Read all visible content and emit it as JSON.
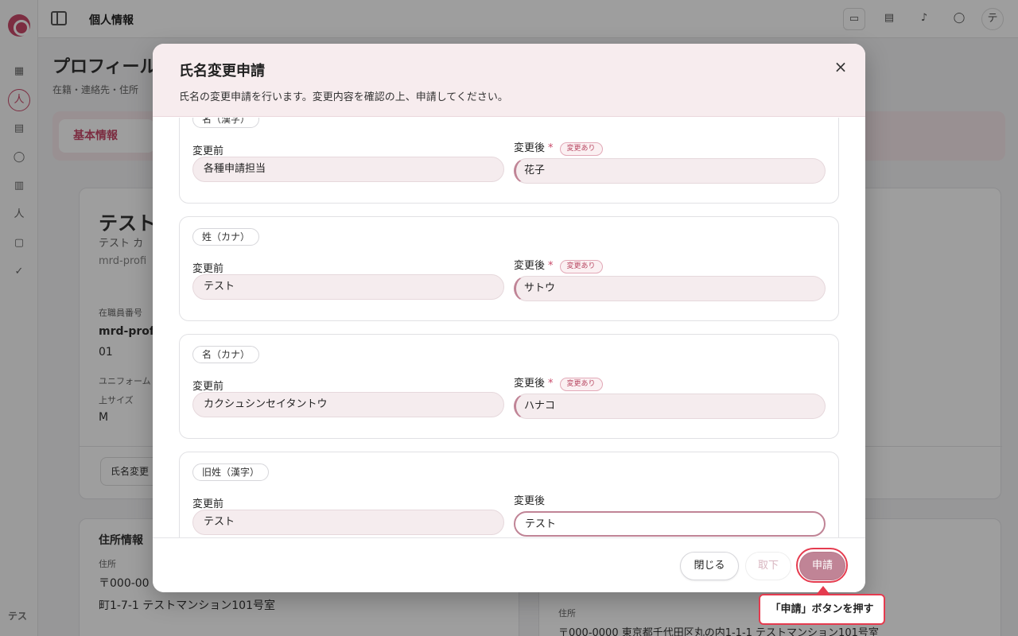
{
  "app": {
    "header_title": "個人情報",
    "sidebar_avatar": "テス",
    "top_avatar": "テ"
  },
  "page": {
    "title": "プロフィール",
    "subtitle": "在籍・連絡先・住所",
    "active_tab": "基本情報",
    "profile_name": "テスト",
    "profile_kana": "テスト カ",
    "profile_id": "mrd-profi",
    "employee_no_label": "在職員番号",
    "employee_no_value": "mrd-profi",
    "employee_no_suffix": "01",
    "uniform_label": "ユニフォーム",
    "top_size_label": "上サイズ",
    "top_size_value": "M",
    "name_change_button": "氏名変更",
    "address_section_title": "住所情報",
    "address_label": "住所",
    "postal": "〒000-00",
    "address_line": "町1-7-1 テストマンション101号室",
    "address_label_right": "住所",
    "address_right": "〒000-0000 東京都千代田区丸の内1-1-1 テストマンション101号室"
  },
  "modal": {
    "title": "氏名変更申請",
    "description": "氏名の変更申請を行います。変更内容を確認の上、申請してください。",
    "before_label": "変更前",
    "after_label": "変更後",
    "required_mark": "*",
    "changed_badge": "変更あり",
    "sections": [
      {
        "field": "名（漢字）",
        "before": "各種申請担当",
        "after": "花子",
        "changed": true
      },
      {
        "field": "姓（カナ）",
        "before": "テスト",
        "after": "サトウ",
        "changed": true
      },
      {
        "field": "名（カナ）",
        "before": "カクシュシンセイタントウ",
        "after": "ハナコ",
        "changed": true
      },
      {
        "field": "旧姓（漢字）",
        "before": "テスト",
        "after": "テスト",
        "changed": false
      }
    ],
    "buttons": {
      "close": "閉じる",
      "withdraw": "取下",
      "submit": "申請"
    }
  },
  "callout": {
    "text": "「申請」ボタンを押す"
  },
  "colors": {
    "accent": "#c94a6a",
    "submit_button": "#c08496",
    "highlight": "#e53b4f"
  }
}
